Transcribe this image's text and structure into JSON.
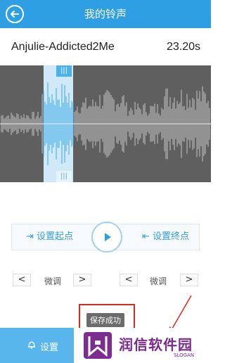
{
  "header": {
    "title": "我的铃声",
    "back_icon": "back-arrow-icon"
  },
  "song": {
    "name": "Anjulie-Addicted2Me",
    "duration": "23.20s"
  },
  "waveform": {
    "selection_handle_top": "|||",
    "selection_handle_bottom": "|||"
  },
  "controls": {
    "set_start_label": "设置起点",
    "set_end_label": "设置终点",
    "play_icon": "play-icon"
  },
  "fine_tune": {
    "left": {
      "label": "微调",
      "prev": "<",
      "next": ">"
    },
    "right": {
      "label": "微调",
      "prev": "<",
      "next": ">"
    }
  },
  "toast": {
    "text": "保存成功"
  },
  "bottom_bar": {
    "settings_label": "设置",
    "settings_icon": "bell-icon"
  },
  "watermark": {
    "brand": "润信软件园",
    "slogan": "SLOGAN"
  },
  "colors": {
    "accent": "#2f9fe4",
    "highlight": "#e3271c",
    "brand": "#7a2b8c"
  }
}
